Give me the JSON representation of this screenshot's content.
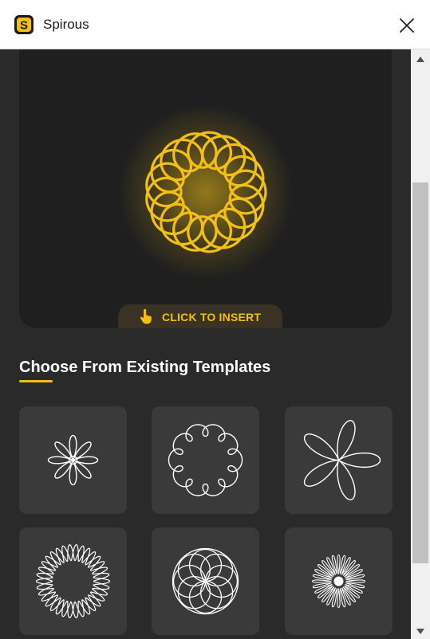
{
  "app": {
    "title": "Spirous",
    "icon": "spirous-logo-icon"
  },
  "window": {
    "close_icon": "close-icon"
  },
  "preview": {
    "insert_label": "CLICK TO INSERT",
    "insert_icon": "pointer-hand-icon",
    "pattern_color": "#f2c014"
  },
  "templates": {
    "heading": "Choose From Existing Templates",
    "accent": "#f2c014",
    "tiles": [
      "flower-template-icon",
      "loop-ring-template-icon",
      "propeller-template-icon",
      "star-ring-template-icon",
      "overlapping-circles-template-icon",
      "dense-petal-template-icon"
    ]
  },
  "colors": {
    "background": "#2a2a2a",
    "tile": "#3a3a3a",
    "preview_bg": "#1f1f1f",
    "accent": "#f2c014"
  }
}
